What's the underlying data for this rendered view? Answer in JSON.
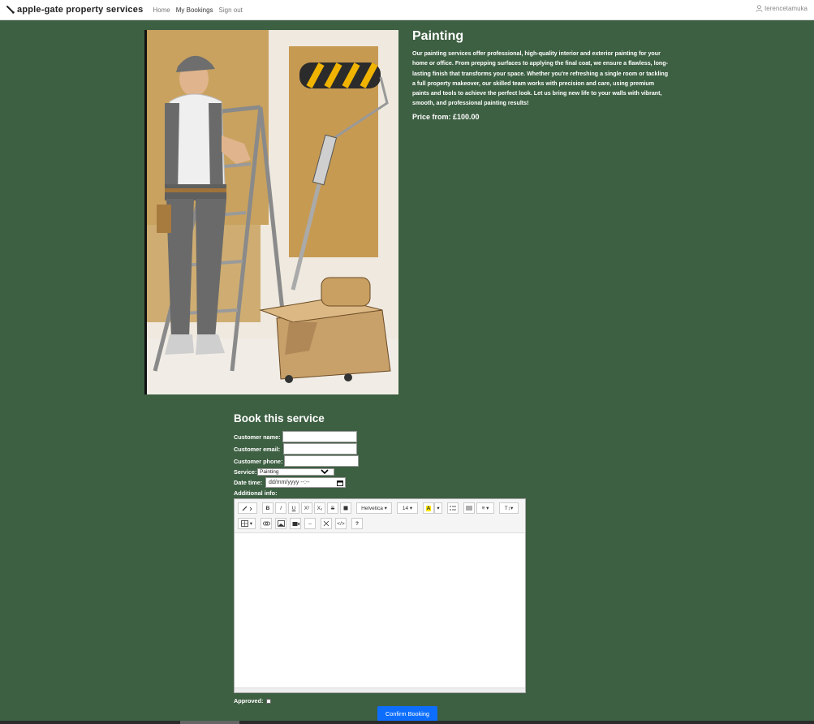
{
  "nav": {
    "brand": "apple-gate property services",
    "links": [
      "Home",
      "My Bookings",
      "Sign out"
    ],
    "user": "terencetamuka"
  },
  "service": {
    "title": "Painting",
    "description": "Our painting services offer professional, high-quality interior and exterior painting for your home or office. From prepping surfaces to applying the final coat, we ensure a flawless, long-lasting finish that transforms your space. Whether you're refreshing a single room or tackling a full property makeover, our skilled team works with precision and care, using premium paints and tools to achieve the perfect look. Let us bring new life to your walls with vibrant, smooth, and professional painting results!",
    "price": "Price from: £100.00"
  },
  "form": {
    "title": "Book this service",
    "customer_name_label": "Customer name:",
    "customer_email_label": "Customer email:",
    "customer_phone_label": "Customer phone:",
    "service_label": "Service:",
    "service_value": "Painting",
    "datetime_label": "Date time:",
    "datetime_placeholder": "dd/mm/yyyy --:--",
    "additional_label": "Additional info:",
    "approved_label": "Approved:",
    "confirm_label": "Confirm Booking"
  },
  "editor": {
    "font_name": "Helvetica",
    "font_size": "14",
    "buttons": {
      "bold": "B",
      "italic": "I",
      "underline": "U",
      "superscript": "X²",
      "subscript": "X₂",
      "strike": "S",
      "color": "A",
      "style": "T",
      "code": "</>",
      "help": "?"
    }
  },
  "colors": {
    "background": "#3d5f42",
    "primary": "#0d6efd"
  }
}
